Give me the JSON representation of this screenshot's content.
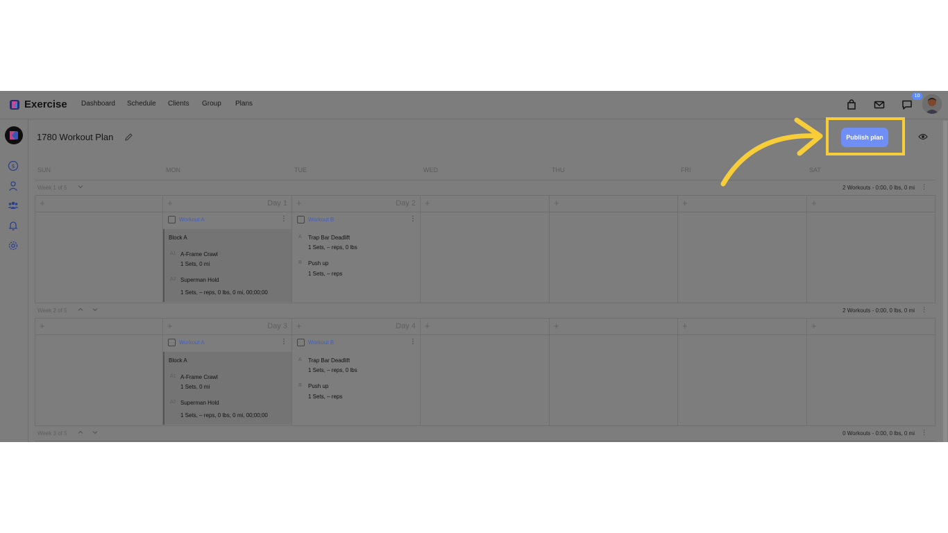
{
  "brand": "Exercise",
  "nav": [
    "Dashboard",
    "Schedule",
    "Clients",
    "Group",
    "Plans"
  ],
  "notifications_count": "10",
  "plan_title": "1780 Workout Plan",
  "publish_label": "Publish plan",
  "days": [
    "SUN",
    "MON",
    "TUE",
    "WED",
    "THU",
    "FRI",
    "SAT"
  ],
  "weeks": [
    {
      "label": "Week 1 of 5",
      "summary": "2 Workouts - 0:00, 0 lbs, 0 mi",
      "mon_day": "Day 1",
      "tue_day": "Day 2",
      "workout_a": {
        "name": "Workout A",
        "block": "Block A",
        "ex1_label": "A1",
        "ex1_name": "A-Frame Crawl",
        "ex1_detail": "1 Sets, 0 mi",
        "ex2_label": "A2",
        "ex2_name": "Superman Hold",
        "ex2_detail": "1 Sets, – reps, 0 lbs, 0 mi, 00;00;00"
      },
      "workout_b": {
        "name": "Workout B",
        "ex1_label": "A",
        "ex1_name": "Trap Bar Deadlift",
        "ex1_detail": "1 Sets, – reps, 0 lbs",
        "ex2_label": "B",
        "ex2_name": "Push up",
        "ex2_detail": "1 Sets, – reps"
      }
    },
    {
      "label": "Week 2 of 5",
      "summary": "2 Workouts - 0:00, 0 lbs, 0 mi",
      "mon_day": "Day 3",
      "tue_day": "Day 4",
      "workout_a": {
        "name": "Workout A",
        "block": "Block A",
        "ex1_label": "A1",
        "ex1_name": "A-Frame Crawl",
        "ex1_detail": "1 Sets, 0 mi",
        "ex2_label": "A2",
        "ex2_name": "Superman Hold",
        "ex2_detail": "1 Sets, – reps, 0 lbs, 0 mi, 00;00;00"
      },
      "workout_b": {
        "name": "Workout B",
        "ex1_label": "A",
        "ex1_name": "Trap Bar Deadlift",
        "ex1_detail": "1 Sets, – reps, 0 lbs",
        "ex2_label": "B",
        "ex2_name": "Push up",
        "ex2_detail": "1 Sets, – reps"
      }
    },
    {
      "label": "Week 3 of 5",
      "summary": "0 Workouts - 0:00, 0 lbs, 0 mi"
    }
  ],
  "colors": {
    "highlight": "#f7cd3a",
    "publish": "#6f8ff6",
    "overlay": "#7d7d7d"
  },
  "icons": [
    "logo-icon",
    "bag-icon",
    "mail-icon",
    "chat-icon",
    "dollar-icon",
    "user-icon",
    "group-icon",
    "bell-icon",
    "gear-icon",
    "pencil-icon",
    "eye-icon",
    "arrow-annotation"
  ]
}
